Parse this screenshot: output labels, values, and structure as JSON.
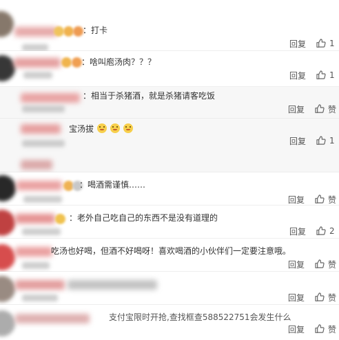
{
  "comments": [
    {
      "text": "：打卡",
      "reply_label": "回复",
      "like_label": "1",
      "emoji_count": 0
    },
    {
      "text": "：啥叫庖汤肉？？？",
      "reply_label": "回复",
      "like_label": "1",
      "emoji_count": 0
    },
    {
      "text": "：相当于杀猪酒，就是杀猪请客吃饭",
      "reply_label": "回复",
      "like_label": "赞",
      "emoji_count": 0
    },
    {
      "text": "宝汤拔",
      "reply_label": "回复",
      "like_label": "1",
      "emoji_count": 3
    },
    {
      "text": "：喝酒需谨慎……",
      "reply_label": "回复",
      "like_label": "赞",
      "emoji_count": 0
    },
    {
      "text": "：老外自己吃自己的东西不是没有道理的",
      "reply_label": "回复",
      "like_label": "2",
      "emoji_count": 0
    },
    {
      "text": "吃汤也好喝，但酒不好喝呀！喜欢喝酒的小伙伴们一定要注意哦。",
      "reply_label": "回复",
      "like_label": "赞",
      "emoji_count": 0
    },
    {
      "text": "",
      "reply_label": "回复",
      "like_label": "赞",
      "emoji_count": 0
    },
    {
      "text": "支付宝限时开抢,查找框查588522751会发生什么",
      "reply_label": "回复",
      "like_label": "赞",
      "emoji_count": 0
    }
  ]
}
